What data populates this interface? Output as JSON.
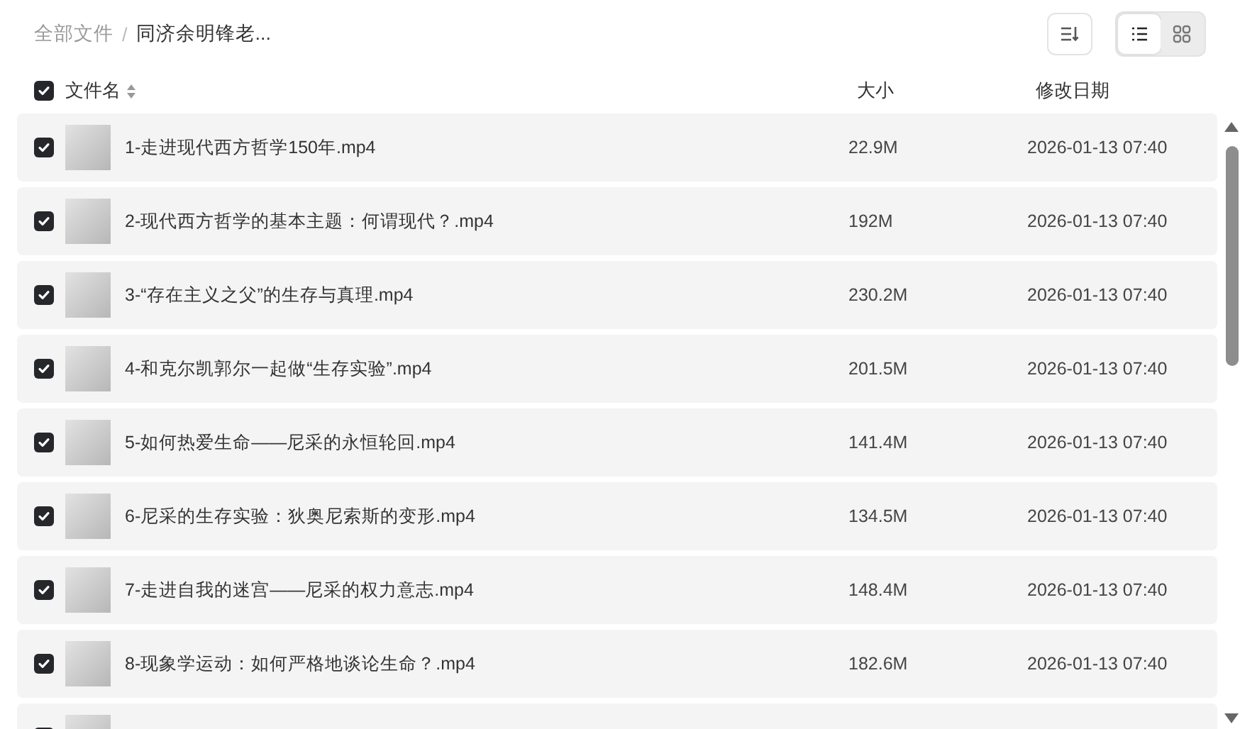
{
  "breadcrumb": {
    "root": "全部文件",
    "separator": "/",
    "current": "同济余明锋老..."
  },
  "view_toggle": [
    {
      "kind": "list",
      "selected": true
    },
    {
      "kind": "grid",
      "selected": false
    }
  ],
  "header": {
    "checked": true,
    "columns": [
      "文件名",
      "大小",
      "修改日期"
    ]
  },
  "rows": [
    {
      "checked": true,
      "name": "1-走进现代西方哲学150年.mp4",
      "size": "22.9M",
      "date": "2026-01-13 07:40"
    },
    {
      "checked": true,
      "name": "2-现代西方哲学的基本主题：何谓现代？.mp4",
      "size": "192M",
      "date": "2026-01-13 07:40"
    },
    {
      "checked": true,
      "name": "3-“存在主义之父”的生存与真理.mp4",
      "size": "230.2M",
      "date": "2026-01-13 07:40"
    },
    {
      "checked": true,
      "name": "4-和克尔凯郭尔一起做“生存实验”.mp4",
      "size": "201.5M",
      "date": "2026-01-13 07:40"
    },
    {
      "checked": true,
      "name": "5-如何热爱生命——尼采的永恒轮回.mp4",
      "size": "141.4M",
      "date": "2026-01-13 07:40"
    },
    {
      "checked": true,
      "name": "6-尼采的生存实验：狄奥尼索斯的变形.mp4",
      "size": "134.5M",
      "date": "2026-01-13 07:40"
    },
    {
      "checked": true,
      "name": "7-走进自我的迷宫——尼采的权力意志.mp4",
      "size": "148.4M",
      "date": "2026-01-13 07:40"
    },
    {
      "checked": true,
      "name": "8-现象学运动：如何严格地谈论生命？.mp4",
      "size": "182.6M",
      "date": "2026-01-13 07:40"
    },
    {
      "checked": true
    }
  ]
}
